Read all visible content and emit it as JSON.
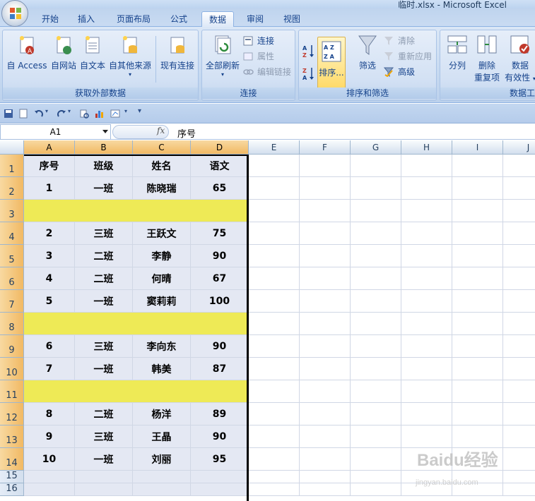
{
  "window": {
    "title": "临时.xlsx - Microsoft Excel"
  },
  "tabs": [
    "开始",
    "插入",
    "页面布局",
    "公式",
    "数据",
    "审阅",
    "视图"
  ],
  "active_tab": "数据",
  "ribbon": {
    "external_group": {
      "label": "获取外部数据",
      "buttons": [
        "自 Access",
        "自网站",
        "自文本",
        "自其他来源",
        "现有连接"
      ]
    },
    "connections_group": {
      "label": "连接",
      "refresh": "全部刷新",
      "connections": "连接",
      "properties": "属性",
      "edit_links": "编辑链接"
    },
    "sort_group": {
      "label": "排序和筛选",
      "sort": "排序...",
      "filter": "筛选",
      "clear": "清除",
      "reapply": "重新应用",
      "advanced": "高级"
    },
    "tools_group": {
      "label": "数据工",
      "split": "分列",
      "remove_dup_1": "删除",
      "remove_dup_2": "重复项",
      "validation_1": "数据",
      "validation_2": "有效性"
    }
  },
  "formula_bar": {
    "name_box": "A1",
    "fx": "fx",
    "value": "序号"
  },
  "columns": [
    "A",
    "B",
    "C",
    "D",
    "E",
    "F",
    "G",
    "H",
    "I",
    "J"
  ],
  "rows": [
    {
      "n": "1",
      "cells": [
        "序号",
        "班级",
        "姓名",
        "语文"
      ],
      "hl": false
    },
    {
      "n": "2",
      "cells": [
        "1",
        "一班",
        "陈晓瑞",
        "65"
      ],
      "hl": false
    },
    {
      "n": "3",
      "cells": [
        "",
        "",
        "",
        ""
      ],
      "hl": true
    },
    {
      "n": "4",
      "cells": [
        "2",
        "三班",
        "王跃文",
        "75"
      ],
      "hl": false
    },
    {
      "n": "5",
      "cells": [
        "3",
        "二班",
        "李静",
        "90"
      ],
      "hl": false
    },
    {
      "n": "6",
      "cells": [
        "4",
        "二班",
        "何晴",
        "67"
      ],
      "hl": false
    },
    {
      "n": "7",
      "cells": [
        "5",
        "一班",
        "窦莉莉",
        "100"
      ],
      "hl": false
    },
    {
      "n": "8",
      "cells": [
        "",
        "",
        "",
        ""
      ],
      "hl": true
    },
    {
      "n": "9",
      "cells": [
        "6",
        "三班",
        "李向东",
        "90"
      ],
      "hl": false
    },
    {
      "n": "10",
      "cells": [
        "7",
        "一班",
        "韩美",
        "87"
      ],
      "hl": false
    },
    {
      "n": "11",
      "cells": [
        "",
        "",
        "",
        ""
      ],
      "hl": true
    },
    {
      "n": "12",
      "cells": [
        "8",
        "二班",
        "杨洋",
        "89"
      ],
      "hl": false
    },
    {
      "n": "13",
      "cells": [
        "9",
        "三班",
        "王晶",
        "90"
      ],
      "hl": false
    },
    {
      "n": "14",
      "cells": [
        "10",
        "一班",
        "刘丽",
        "95"
      ],
      "hl": false
    },
    {
      "n": "15",
      "cells": [
        "",
        "",
        "",
        ""
      ],
      "hl": false
    },
    {
      "n": "16",
      "cells": [
        "",
        "",
        "",
        ""
      ],
      "hl": false
    }
  ],
  "colors": {
    "highlight_row": "#eeea56",
    "selected_header": "#f1b963"
  },
  "watermark": {
    "line1": "Baidu经验",
    "line2": "jingyan.baidu.com"
  }
}
